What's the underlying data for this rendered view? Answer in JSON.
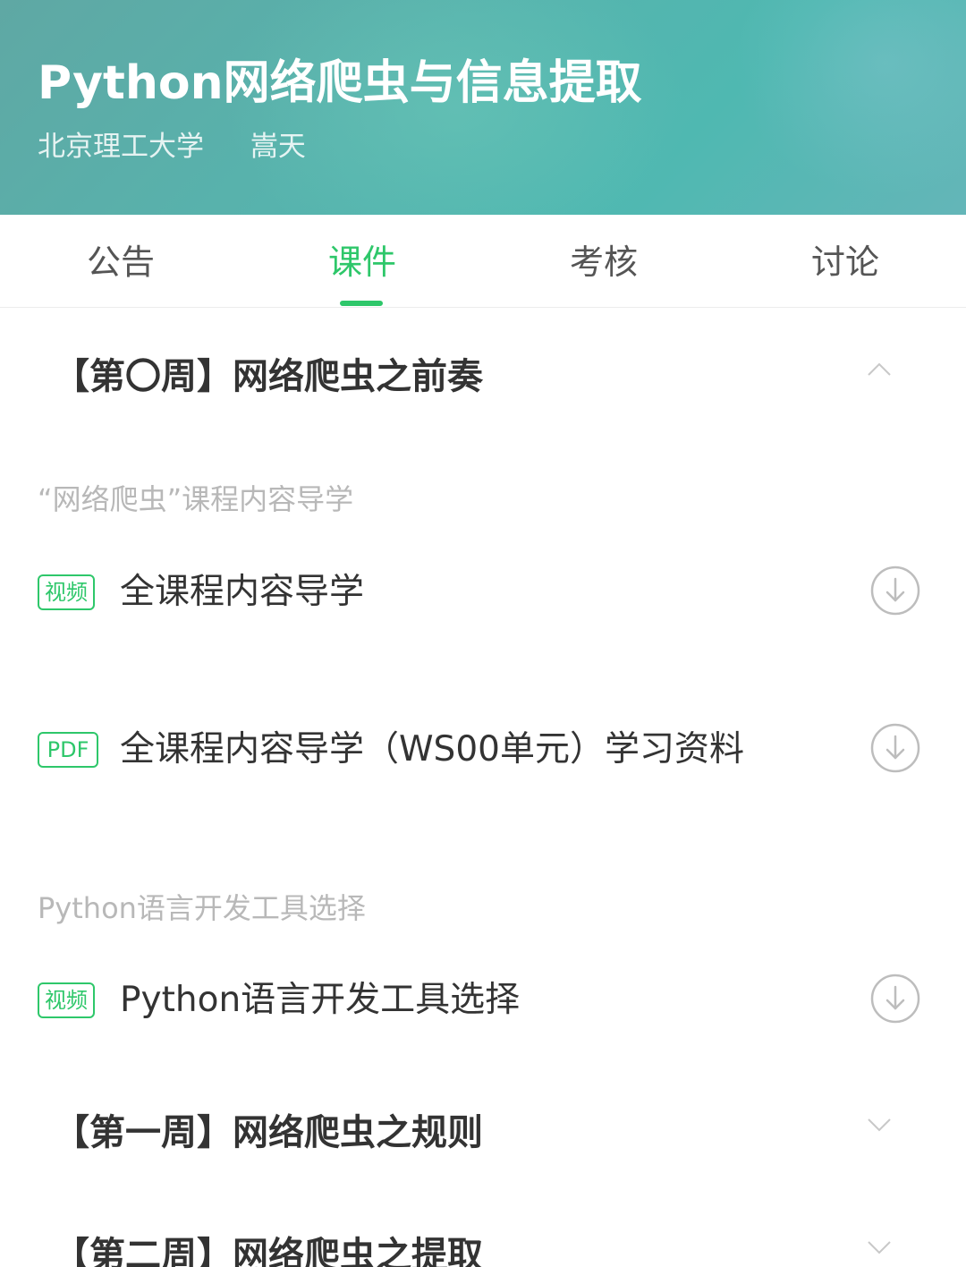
{
  "course": {
    "title": "Python网络爬虫与信息提取",
    "school": "北京理工大学",
    "teacher": "嵩天"
  },
  "tabs": [
    {
      "label": "公告",
      "active": false
    },
    {
      "label": "课件",
      "active": true
    },
    {
      "label": "考核",
      "active": false
    },
    {
      "label": "讨论",
      "active": false
    }
  ],
  "weeks": [
    {
      "title": "【第〇周】网络爬虫之前奏",
      "expanded": true,
      "sections": [
        {
          "label": "“网络爬虫”课程内容导学",
          "items": [
            {
              "type": "视频",
              "title": "全课程内容导学"
            },
            {
              "type": "PDF",
              "title": "全课程内容导学（WS00单元）学习资料"
            }
          ]
        },
        {
          "label": "Python语言开发工具选择",
          "items": [
            {
              "type": "视频",
              "title": "Python语言开发工具选择"
            }
          ]
        }
      ]
    },
    {
      "title": "【第一周】网络爬虫之规则",
      "expanded": false
    },
    {
      "title": "【第二周】网络爬虫之提取",
      "expanded": false
    }
  ],
  "colors": {
    "accent": "#2ec76a",
    "header_bg": "#57b3ad",
    "text_primary": "#333333",
    "text_muted": "#b8b8b8"
  },
  "icons": {
    "download": "download-circle-icon",
    "collapse": "chevron-up-icon",
    "expand": "chevron-down-icon"
  }
}
